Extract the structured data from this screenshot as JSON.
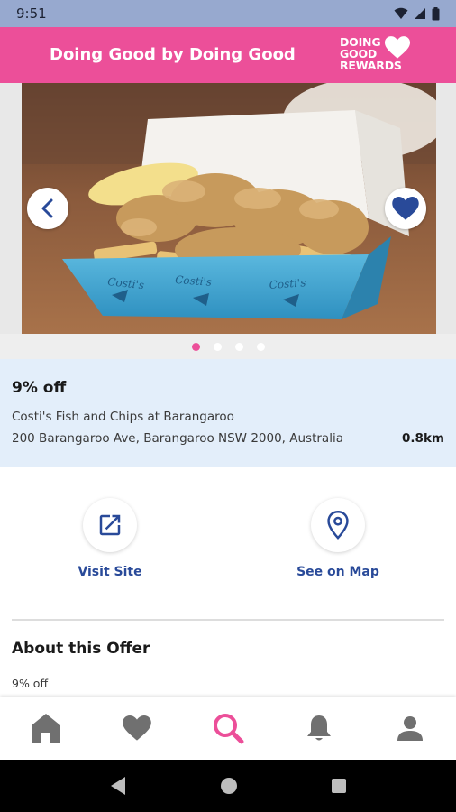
{
  "status_bar": {
    "time": "9:51"
  },
  "header": {
    "title": "Doing Good by Doing Good",
    "logo_line1": "DOING",
    "logo_line2": "GOOD",
    "logo_line3": "REWARDS",
    "color": "#ec4f99"
  },
  "hero": {
    "box_text": [
      "Costi's",
      "Costi's",
      "Costi's"
    ],
    "carousel_count": 4,
    "carousel_active": 1
  },
  "offer": {
    "discount": "9% off",
    "venue": "Costi's Fish and Chips at Barangaroo",
    "address": "200 Barangaroo Ave, Barangaroo NSW 2000, Australia",
    "distance": "0.8km"
  },
  "actions": {
    "visit_label": "Visit Site",
    "map_label": "See on Map"
  },
  "about": {
    "title": "About this Offer",
    "text": "9% off"
  },
  "nav": {
    "items": [
      "home-icon",
      "heart-icon",
      "search-icon",
      "bell-icon",
      "profile-icon"
    ],
    "active": "search-icon",
    "active_color": "#ec4f99",
    "inactive_color": "#707070"
  }
}
